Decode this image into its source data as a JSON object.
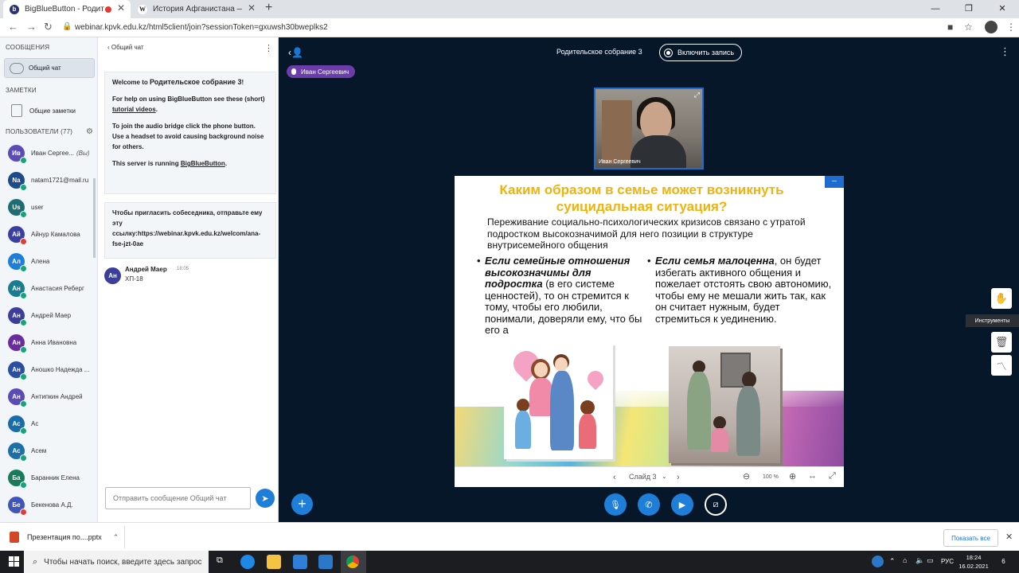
{
  "browser": {
    "tabs": [
      {
        "label": "BigBlueButton - Родительс",
        "active": true,
        "recording": true
      },
      {
        "label": "История Афганистана — Викип",
        "active": false
      }
    ],
    "new_tab": "+",
    "url": "webinar.kpvk.edu.kz/html5client/join?sessionToken=gxuwsh30bweplks2"
  },
  "left_panel": {
    "messages_header": "СООБЩЕНИЯ",
    "public_chat": "Общий чат",
    "notes_header": "ЗАМЕТКИ",
    "shared_notes": "Общие заметки",
    "users_header": "ПОЛЬЗОВАТЕЛИ (77)",
    "users": [
      {
        "initials": "Ив",
        "name": "Иван Сергее...",
        "suffix": "(Вы)",
        "color": "#5b4bb5",
        "status": "#1aa37a"
      },
      {
        "initials": "Na",
        "name": "natam1721@mail.ru",
        "color": "#1e4a8a",
        "status": "#1aa37a"
      },
      {
        "initials": "Us",
        "name": "user",
        "color": "#1e6d73",
        "status": "#1aa37a"
      },
      {
        "initials": "Ай",
        "name": "Айнур Камалова",
        "color": "#3a3f9e",
        "status": "#d9403a"
      },
      {
        "initials": "Ал",
        "name": "Алена",
        "color": "#1e7ed8",
        "status": "#1aa37a"
      },
      {
        "initials": "Ан",
        "name": "Анастасия Реберг",
        "color": "#1a7d8f",
        "status": "#1aa37a"
      },
      {
        "initials": "Ан",
        "name": "Андрей Маер",
        "color": "#3c3f99",
        "status": "#1aa37a"
      },
      {
        "initials": "Ан",
        "name": "Анна Ивановна",
        "color": "#6a2d9e",
        "status": "#1aa37a"
      },
      {
        "initials": "Ан",
        "name": "Аношко Надежда ...",
        "color": "#2a4ea0",
        "status": "#1aa37a"
      },
      {
        "initials": "Ан",
        "name": "Антипкин Андрей",
        "color": "#5b4bb5",
        "status": "#1aa37a"
      },
      {
        "initials": "Ас",
        "name": "Ас",
        "color": "#1a6da8",
        "status": "#1aa37a"
      },
      {
        "initials": "Ас",
        "name": "Асем",
        "color": "#1e6fa8",
        "status": "#1aa37a"
      },
      {
        "initials": "Ба",
        "name": "Баранник Елена",
        "color": "#1a7a5a",
        "status": "#1aa37a"
      },
      {
        "initials": "Бе",
        "name": "Бекенова А.Д.",
        "color": "#3f56b8",
        "status": "#d9403a"
      }
    ]
  },
  "chat": {
    "header": "Общий чат",
    "welcome": {
      "line1_a": "Welcome to ",
      "line1_b": "Родительское собрание 3",
      "line1_c": "!",
      "help_a": "For help on using BigBlueButton see these (short) ",
      "help_link": "tutorial videos",
      "help_b": ".",
      "audio": "To join the audio bridge click the phone button. Use a headset to avoid causing background noise for others.",
      "server_a": "This server is running ",
      "server_link": "BigBlueButton",
      "server_b": "."
    },
    "invite": "Чтобы пригласить собеседника, отправьте ему эту ссылку:https://webinar.kpvk.edu.kz/welcom/ana-fse-jzt-0ae",
    "message": {
      "initials": "Ан",
      "author": "Андрей Маер",
      "time": "18:05",
      "text": "ХП-18",
      "color": "#3c3f99"
    },
    "input_placeholder": "Отправить сообщение Общий чат"
  },
  "meeting": {
    "title": "Родительское собрание 3",
    "record_button": "Включить запись",
    "talker": "Иван Сергеевич",
    "webcam_label": "Иван Сергеевич"
  },
  "slide": {
    "title_line1": "Каким образом в семье может возникнуть",
    "title_line2": "суицидальная ситуация?",
    "intro": "Переживание социально-психологических кризисов связано с утратой подростком высокозначимой для него позиции в структуре внутрисемейного общения",
    "col1_bold": "Если семейные отношения высокозначимы для подростка",
    "col1_rest": " (в его системе ценностей), то он стремится к тому, чтобы его любили, понимали, доверяли ему, что бы его а",
    "col2_bold": "Если семья малоценна",
    "col2_rest": ", он будет избегать активного общения и пожелает отстоять свою автономию, чтобы ему не мешали жить так, как он считает нужным, будет стремиться к уединению.",
    "slide_label": "Слайд 3",
    "zoom": "100 %",
    "min_button": "–"
  },
  "tools": {
    "tooltip": "Инструменты"
  },
  "downloads": {
    "file": "Презентация по....pptx",
    "show_all": "Показать все"
  },
  "taskbar": {
    "search": "Чтобы начать поиск, введите здесь запрос",
    "language": "РУС",
    "time": "18:24",
    "date": "16.02.2021",
    "notifications": "6"
  }
}
